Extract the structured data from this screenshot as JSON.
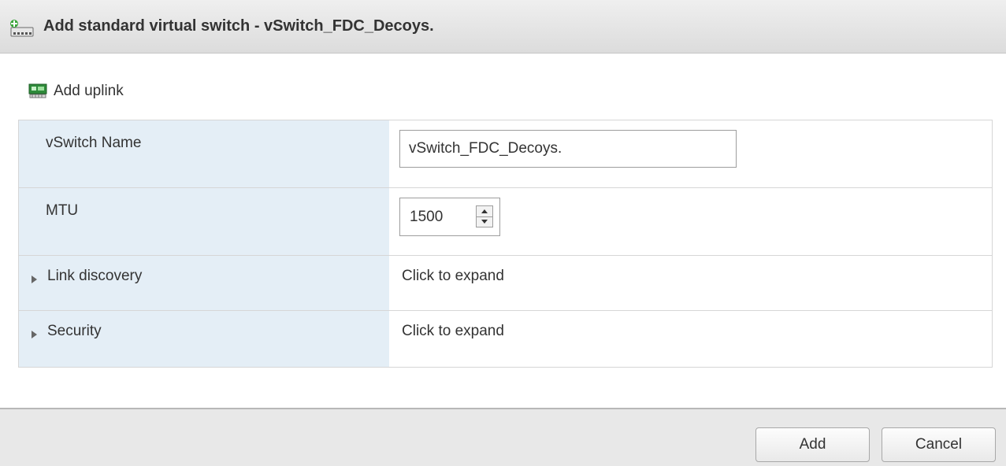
{
  "dialog": {
    "title": "Add standard virtual switch - vSwitch_FDC_Decoys.",
    "title_icon": "virtual-switch-add-icon"
  },
  "toolbar": {
    "add_uplink_label": "Add uplink",
    "add_uplink_icon": "network-adapter-icon"
  },
  "form": {
    "vswitch_name": {
      "label": "vSwitch Name",
      "value": "vSwitch_FDC_Decoys."
    },
    "mtu": {
      "label": "MTU",
      "value": "1500"
    },
    "link_discovery": {
      "label": "Link discovery",
      "value": "Click to expand"
    },
    "security": {
      "label": "Security",
      "value": "Click to expand"
    }
  },
  "footer": {
    "add_label": "Add",
    "cancel_label": "Cancel"
  },
  "colors": {
    "label_column_bg": "#e4eef6",
    "titlebar_bg": "#e4e4e4",
    "footer_bg": "#e8e8e8"
  }
}
